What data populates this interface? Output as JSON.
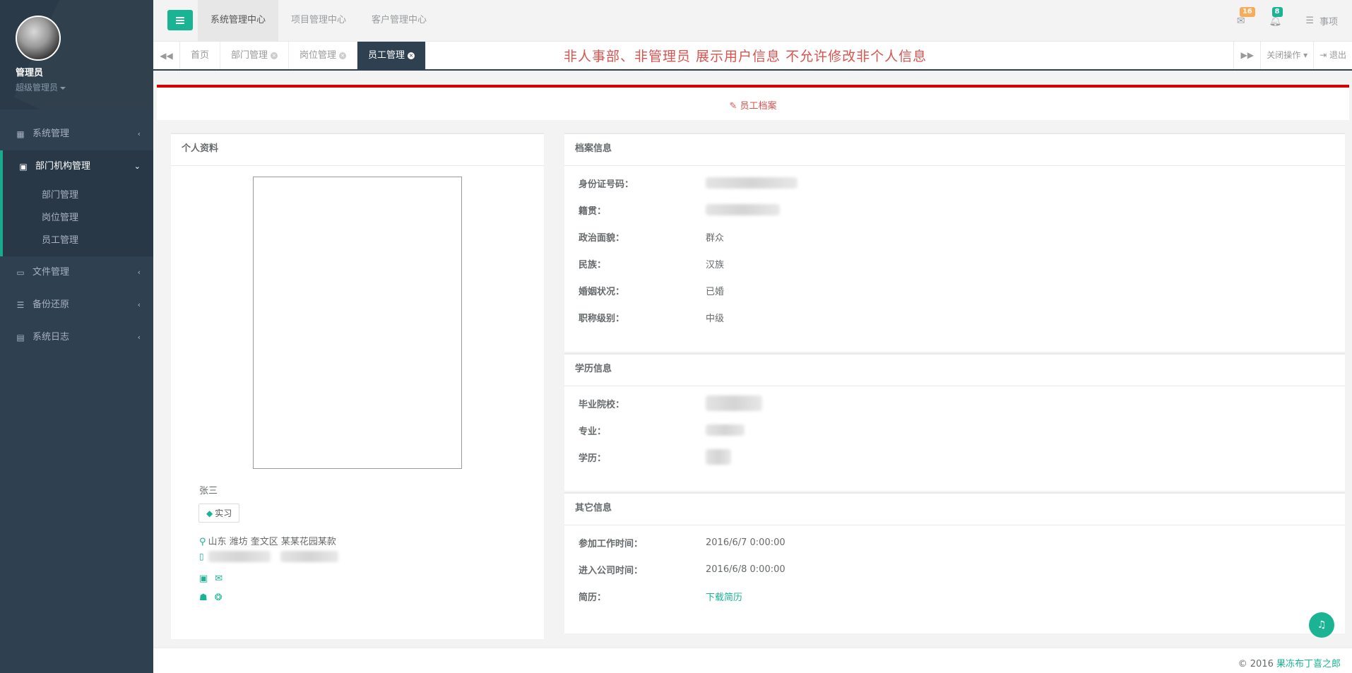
{
  "user": {
    "name": "管理员",
    "role": "超级管理员"
  },
  "sidebar": {
    "items": [
      {
        "label": "系统管理",
        "icon": "grid-icon"
      },
      {
        "label": "部门机构管理",
        "icon": "building-icon",
        "children": [
          "部门管理",
          "岗位管理",
          "员工管理"
        ]
      },
      {
        "label": "文件管理",
        "icon": "folder-open-icon"
      },
      {
        "label": "备份还原",
        "icon": "database-icon"
      },
      {
        "label": "系统日志",
        "icon": "file-text-icon"
      }
    ]
  },
  "topbar": {
    "tabs": [
      "系统管理中心",
      "项目管理中心",
      "客户管理中心"
    ],
    "mail_count": "16",
    "bell_count": "8",
    "tasks_label": "事项"
  },
  "tabsbar": {
    "tabs": [
      "首页",
      "部门管理",
      "岗位管理",
      "员工管理"
    ],
    "notice": "非人事部、非管理员 展示用户信息 不允许修改非个人信息",
    "close_ops": "关闭操作",
    "logout": "退出"
  },
  "page": {
    "title": "员工档案"
  },
  "personal": {
    "title": "个人资料",
    "name": "张三",
    "tag": "实习",
    "address": "山东 潍坊 奎文区  某某花园某款"
  },
  "archive": {
    "title": "档案信息",
    "rows": [
      {
        "label": "身份证号码：",
        "value": ""
      },
      {
        "label": "籍贯：",
        "value": ""
      },
      {
        "label": "政治面貌：",
        "value": "群众"
      },
      {
        "label": "民族：",
        "value": "汉族"
      },
      {
        "label": "婚姻状况：",
        "value": "已婚"
      },
      {
        "label": "职称级别：",
        "value": "中级"
      }
    ]
  },
  "education": {
    "title": "学历信息",
    "rows": [
      {
        "label": "毕业院校：",
        "value": ""
      },
      {
        "label": "专业：",
        "value": ""
      },
      {
        "label": "学历：",
        "value": ""
      }
    ]
  },
  "other": {
    "title": "其它信息",
    "rows": [
      {
        "label": "参加工作时间：",
        "value": "2016/6/7 0:00:00"
      },
      {
        "label": "进入公司时间：",
        "value": "2016/6/8 0:00:00"
      },
      {
        "label": "简历：",
        "value": "下载简历"
      }
    ]
  },
  "footer": {
    "copy": "© 2016",
    "link": "果冻布丁喜之郎"
  },
  "colors": {
    "accent": "#1ab394",
    "sidebar": "#2f4050",
    "danger": "#d60000"
  }
}
